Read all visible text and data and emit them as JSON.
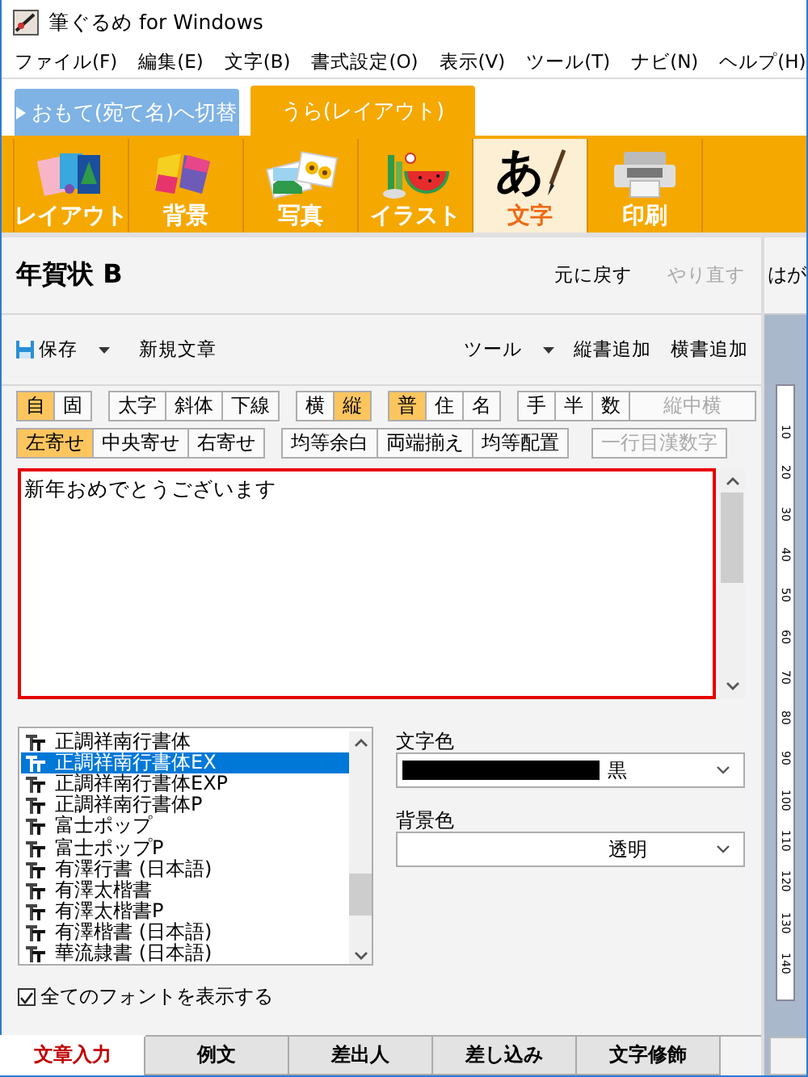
{
  "window": {
    "title": "筆ぐるめ for Windows"
  },
  "menu": [
    {
      "label": "ファイル(F)"
    },
    {
      "label": "編集(E)"
    },
    {
      "label": "文字(B)"
    },
    {
      "label": "書式設定(O)"
    },
    {
      "label": "表示(V)"
    },
    {
      "label": "ツール(T)"
    },
    {
      "label": "ナビ(N)"
    },
    {
      "label": "ヘルプ(H)"
    }
  ],
  "mode_tabs": [
    {
      "label": "おもて(宛て名)へ切替",
      "selected": false
    },
    {
      "label": "うら(レイアウト)",
      "selected": true
    }
  ],
  "ribbon": [
    {
      "label": "レイアウト",
      "selected": false
    },
    {
      "label": "背景",
      "selected": false
    },
    {
      "label": "写真",
      "selected": false
    },
    {
      "label": "イラスト",
      "selected": false
    },
    {
      "label": "文字",
      "selected": true,
      "glyph": "あ"
    },
    {
      "label": "印刷",
      "selected": false
    }
  ],
  "document": {
    "title": "年賀状 B",
    "actions": [
      {
        "label": "元に戻す",
        "disabled": false
      },
      {
        "label": "やり直す",
        "disabled": true
      }
    ]
  },
  "toolbar": {
    "left": [
      {
        "label": "保存",
        "dropdown": true
      },
      {
        "label": "新規文章",
        "dropdown": false
      }
    ],
    "right": [
      {
        "label": "ツール",
        "dropdown": true
      },
      {
        "label": "縦書追加",
        "dropdown": false
      },
      {
        "label": "横書追加",
        "dropdown": false
      }
    ]
  },
  "format_rows": [
    [
      [
        {
          "label": "自",
          "selected": true,
          "disabled": false
        },
        {
          "label": "固",
          "selected": false,
          "disabled": false
        }
      ],
      [
        {
          "label": "太字",
          "selected": false,
          "disabled": false
        },
        {
          "label": "斜体",
          "selected": false,
          "disabled": false
        },
        {
          "label": "下線",
          "selected": false,
          "disabled": false
        }
      ],
      [
        {
          "label": "横",
          "selected": false,
          "disabled": false
        },
        {
          "label": "縦",
          "selected": true,
          "disabled": false
        }
      ],
      [
        {
          "label": "普",
          "selected": true,
          "disabled": false
        },
        {
          "label": "住",
          "selected": false,
          "disabled": false
        },
        {
          "label": "名",
          "selected": false,
          "disabled": false
        }
      ],
      [
        {
          "label": "手",
          "selected": false,
          "disabled": false
        },
        {
          "label": "半",
          "selected": false,
          "disabled": false
        },
        {
          "label": "数",
          "selected": false,
          "disabled": false
        },
        {
          "label": "縦中横",
          "selected": false,
          "disabled": true
        }
      ]
    ],
    [
      [
        {
          "label": "左寄せ",
          "selected": true,
          "disabled": false
        },
        {
          "label": "中央寄せ",
          "selected": false,
          "disabled": false
        },
        {
          "label": "右寄せ",
          "selected": false,
          "disabled": false
        }
      ],
      [
        {
          "label": "均等余白",
          "selected": false,
          "disabled": false
        },
        {
          "label": "両端揃え",
          "selected": false,
          "disabled": false
        },
        {
          "label": "均等配置",
          "selected": false,
          "disabled": false
        }
      ],
      [
        {
          "label": "一行目漢数字",
          "selected": false,
          "disabled": true
        }
      ]
    ]
  ],
  "text_input": {
    "value": "新年おめでとうございます"
  },
  "font_list": [
    {
      "label": "正調祥南行書体",
      "selected": false
    },
    {
      "label": "正調祥南行書体EX",
      "selected": true
    },
    {
      "label": "正調祥南行書体EXP",
      "selected": false
    },
    {
      "label": "正調祥南行書体P",
      "selected": false
    },
    {
      "label": "富士ポップ",
      "selected": false
    },
    {
      "label": "富士ポップP",
      "selected": false
    },
    {
      "label": "有澤行書 (日本語)",
      "selected": false
    },
    {
      "label": "有澤太楷書",
      "selected": false
    },
    {
      "label": "有澤太楷書P",
      "selected": false
    },
    {
      "label": "有澤楷書 (日本語)",
      "selected": false
    },
    {
      "label": "華流隷書 (日本語)",
      "selected": false
    }
  ],
  "text_color": {
    "label": "文字色",
    "value": "黒",
    "color": "#000000"
  },
  "background_color": {
    "label": "背景色",
    "value": "透明"
  },
  "show_all_fonts": {
    "label": "全てのフォントを表示する",
    "checked": true
  },
  "bottom_tabs": [
    {
      "label": "文章入力",
      "selected": true
    },
    {
      "label": "例文",
      "selected": false
    },
    {
      "label": "差出人",
      "selected": false
    },
    {
      "label": "差し込み",
      "selected": false
    },
    {
      "label": "文字修飾",
      "selected": false
    }
  ],
  "preview": {
    "title": "はが",
    "ruler": [
      "10",
      "20",
      "30",
      "40",
      "50",
      "60",
      "70",
      "80",
      "90",
      "100",
      "110",
      "120",
      "130",
      "140"
    ]
  }
}
